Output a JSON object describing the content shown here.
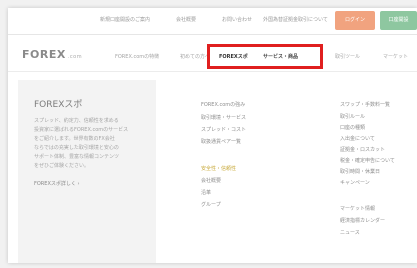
{
  "topbar": {
    "links": [
      "新規口座開設のご案内",
      "会社概要",
      "お問い合わせ",
      "外国為替証拠金取引について"
    ],
    "orange_button": "ログイン",
    "green_button": "口座開設"
  },
  "header": {
    "logo": "FOREX",
    "logo_sub": ".com",
    "nav": [
      "FOREX.comの特徴",
      "初めての方へ",
      "FOREXスポ",
      "サービス・商品",
      "取引ツール",
      "マーケット"
    ]
  },
  "mega": {
    "title": "FOREXスポ",
    "description": [
      "スプレッド、約定力、信頼性を求める",
      "投資家に選ばれるFOREX.comのサービス",
      "をご紹介します。世界有数のFX会社",
      "ならではの充実した取引環境と安心の",
      "サポート体制、豊富な情報コンテンツ",
      "をぜひご体験ください。"
    ],
    "left_link": "FOREXスポ詳しく ›",
    "col1a": [
      "FOREX.comの強み",
      "取引環境・サービス",
      "スプレッド・コスト",
      "取扱通貨ペア一覧"
    ],
    "col1b": [
      "安全性・信頼性",
      "会社概要",
      "沿革",
      "グループ"
    ],
    "col2a": [
      "スワップ・手数料一覧",
      "取引ルール",
      "口座の種類",
      "入出金について",
      "証拠金・ロスカット",
      "税金・確定申告について",
      "取引時間・休業日",
      "キャンペーン"
    ],
    "col2b": [
      "マーケット情報",
      "経済指標カレンダー",
      "ニュース"
    ]
  }
}
